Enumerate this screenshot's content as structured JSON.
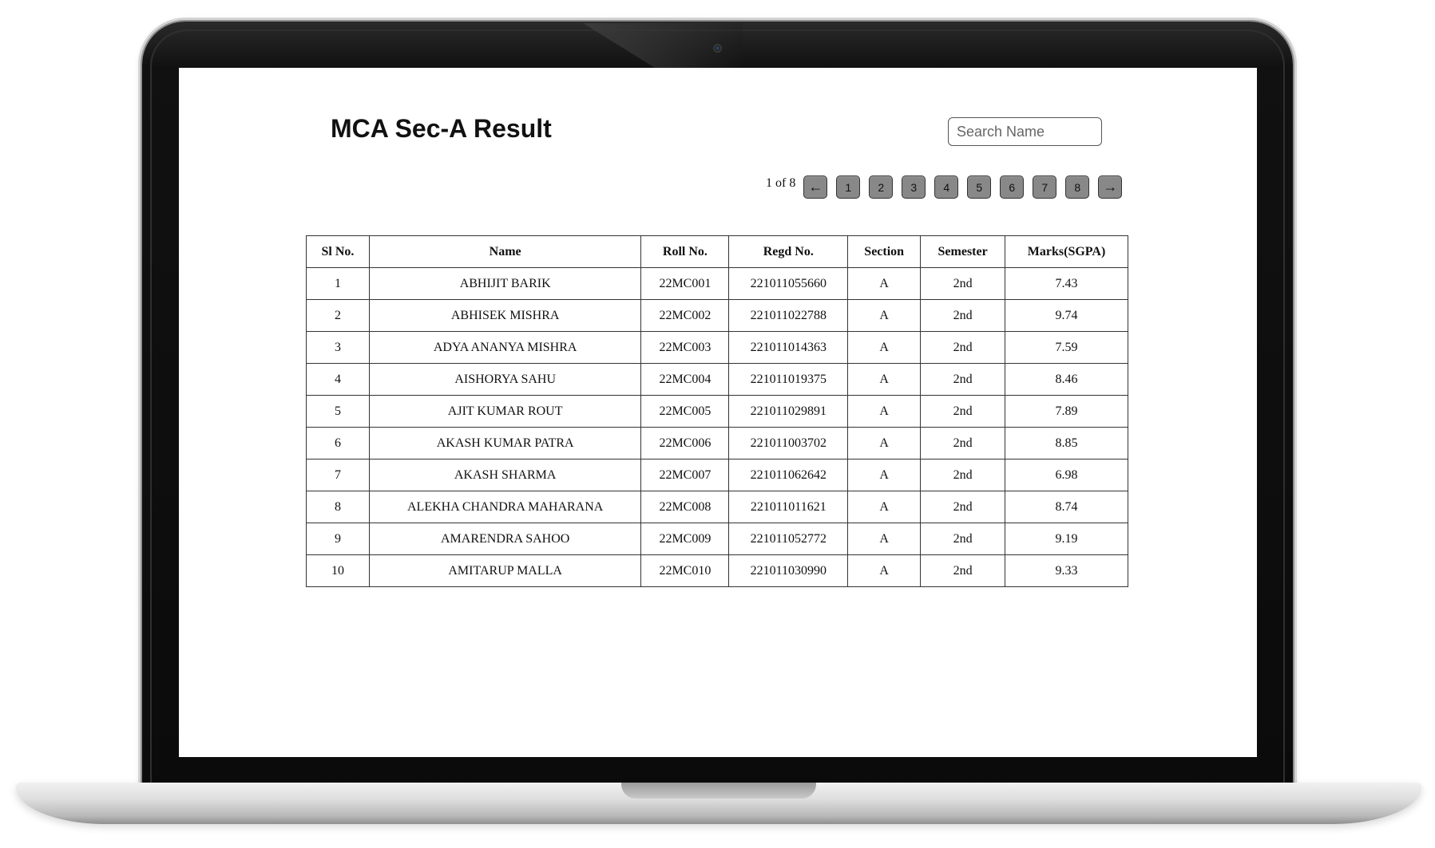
{
  "page": {
    "title": "MCA Sec-A Result",
    "search_placeholder": "Search Name"
  },
  "pagination": {
    "info": "1 of 8",
    "prev_icon": "arrow-left-icon",
    "next_icon": "arrow-right-icon",
    "pages": [
      "1",
      "2",
      "3",
      "4",
      "5",
      "6",
      "7",
      "8"
    ]
  },
  "table": {
    "headers": [
      "Sl No.",
      "Name",
      "Roll No.",
      "Regd No.",
      "Section",
      "Semester",
      "Marks(SGPA)"
    ],
    "rows": [
      [
        "1",
        "ABHIJIT BARIK",
        "22MC001",
        "221011055660",
        "A",
        "2nd",
        "7.43"
      ],
      [
        "2",
        "ABHISEK MISHRA",
        "22MC002",
        "221011022788",
        "A",
        "2nd",
        "9.74"
      ],
      [
        "3",
        "ADYA ANANYA MISHRA",
        "22MC003",
        "221011014363",
        "A",
        "2nd",
        "7.59"
      ],
      [
        "4",
        "AISHORYA SAHU",
        "22MC004",
        "221011019375",
        "A",
        "2nd",
        "8.46"
      ],
      [
        "5",
        "AJIT KUMAR ROUT",
        "22MC005",
        "221011029891",
        "A",
        "2nd",
        "7.89"
      ],
      [
        "6",
        "AKASH KUMAR PATRA",
        "22MC006",
        "221011003702",
        "A",
        "2nd",
        "8.85"
      ],
      [
        "7",
        "AKASH SHARMA",
        "22MC007",
        "221011062642",
        "A",
        "2nd",
        "6.98"
      ],
      [
        "8",
        "ALEKHA CHANDRA MAHARANA",
        "22MC008",
        "221011011621",
        "A",
        "2nd",
        "8.74"
      ],
      [
        "9",
        "AMARENDRA SAHOO",
        "22MC009",
        "221011052772",
        "A",
        "2nd",
        "9.19"
      ],
      [
        "10",
        "AMITARUP MALLA",
        "22MC010",
        "221011030990",
        "A",
        "2nd",
        "9.33"
      ]
    ]
  }
}
